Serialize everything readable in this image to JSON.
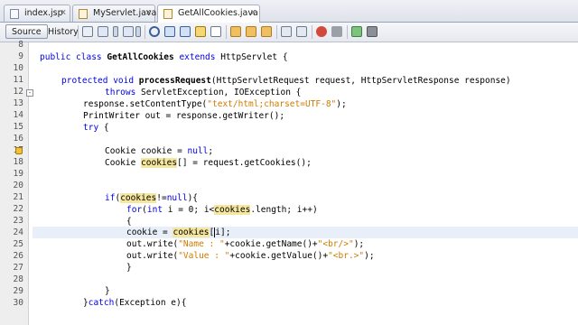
{
  "tabs": [
    {
      "label": "index.jsp",
      "close": "x"
    },
    {
      "label": "MyServlet.java",
      "close": "x"
    },
    {
      "label": "GetAllCookies.java",
      "close": "x"
    }
  ],
  "toolbar": {
    "source_label": "Source",
    "history_label": "History"
  },
  "lines": [
    {
      "num": "8",
      "fold": "",
      "marker": false
    },
    {
      "num": "9",
      "fold": "",
      "marker": false
    },
    {
      "num": "10",
      "fold": "",
      "marker": false
    },
    {
      "num": "11",
      "fold": "",
      "marker": false
    },
    {
      "num": "12",
      "fold": "-",
      "marker": false
    },
    {
      "num": "13",
      "fold": "",
      "marker": false
    },
    {
      "num": "14",
      "fold": "",
      "marker": false
    },
    {
      "num": "15",
      "fold": "",
      "marker": false
    },
    {
      "num": "16",
      "fold": "",
      "marker": false
    },
    {
      "num": "17",
      "fold": "",
      "marker": true
    },
    {
      "num": "18",
      "fold": "",
      "marker": false
    },
    {
      "num": "19",
      "fold": "",
      "marker": false
    },
    {
      "num": "20",
      "fold": "",
      "marker": false
    },
    {
      "num": "21",
      "fold": "",
      "marker": false
    },
    {
      "num": "22",
      "fold": "",
      "marker": false
    },
    {
      "num": "23",
      "fold": "",
      "marker": false
    },
    {
      "num": "24",
      "fold": "",
      "marker": false
    },
    {
      "num": "25",
      "fold": "",
      "marker": false
    },
    {
      "num": "26",
      "fold": "",
      "marker": false
    },
    {
      "num": "27",
      "fold": "",
      "marker": false
    },
    {
      "num": "28",
      "fold": "",
      "marker": false
    },
    {
      "num": "29",
      "fold": "",
      "marker": false
    },
    {
      "num": "30",
      "fold": "",
      "marker": false
    }
  ],
  "code": {
    "l9": {
      "kw1": "public class ",
      "name": "GetAllCookies ",
      "kw2": "extends ",
      "rest": "HttpServlet {"
    },
    "l11": {
      "kw": "protected void ",
      "fn": "processRequest",
      "rest": "(HttpServletRequest request, HttpServletResponse response)"
    },
    "l12": {
      "kw": "throws ",
      "rest": "ServletException, IOException {"
    },
    "l13": {
      "a": "response.setContentType(",
      "s": "\"text/html;charset=UTF-8\"",
      "b": ");"
    },
    "l14": {
      "a": "PrintWriter out = response.getWriter();"
    },
    "l15": {
      "kw": "try ",
      "rest": "{"
    },
    "l17": {
      "a": "Cookie cookie = ",
      "kw": "null",
      "b": ";"
    },
    "l18": {
      "a": "Cookie ",
      "h": "cookies",
      "b": "[] = request.getCookies();"
    },
    "l21": {
      "kw": "if",
      "a": "(",
      "h": "cookies",
      "b": "!=",
      "kw2": "null",
      "c": "){"
    },
    "l22": {
      "kw": "for",
      "a": "(",
      "kw2": "int ",
      "b": "i = 0; i<",
      "h": "cookies",
      "c": ".length; i++)"
    },
    "l23": {
      "a": "{"
    },
    "l24": {
      "a": "cookie = ",
      "h": "cookies",
      "b1": "[",
      "b2": "i];"
    },
    "l25": {
      "a": "out.write(",
      "s1": "\"Name : \"",
      "b": "+cookie.getName()+",
      "s2": "\"<br/>\"",
      "c": ");"
    },
    "l26": {
      "a": "out.write(",
      "s1": "\"Value : \"",
      "b": "+cookie.getValue()+",
      "s2": "\"<br.>\"",
      "c": ");"
    },
    "l27": {
      "a": "}"
    },
    "l29": {
      "a": "}"
    },
    "l30": {
      "a": "}",
      "kw": "catch",
      "b": "(Exception e){"
    }
  }
}
